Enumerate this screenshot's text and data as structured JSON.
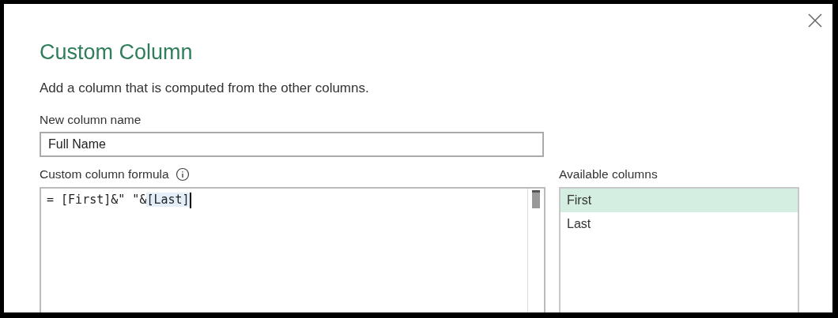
{
  "dialog": {
    "title": "Custom Column",
    "description": "Add a column that is computed from the other columns."
  },
  "name_field": {
    "label": "New column name",
    "value": "Full Name"
  },
  "formula": {
    "label": "Custom column formula",
    "segments": [
      {
        "text": "= [First]&\" \"&",
        "highlighted": false
      },
      {
        "text": "[Last]",
        "highlighted": true
      }
    ]
  },
  "available_columns": {
    "label": "Available columns",
    "items": [
      {
        "label": "First",
        "selected": true
      },
      {
        "label": "Last",
        "selected": false
      }
    ]
  }
}
